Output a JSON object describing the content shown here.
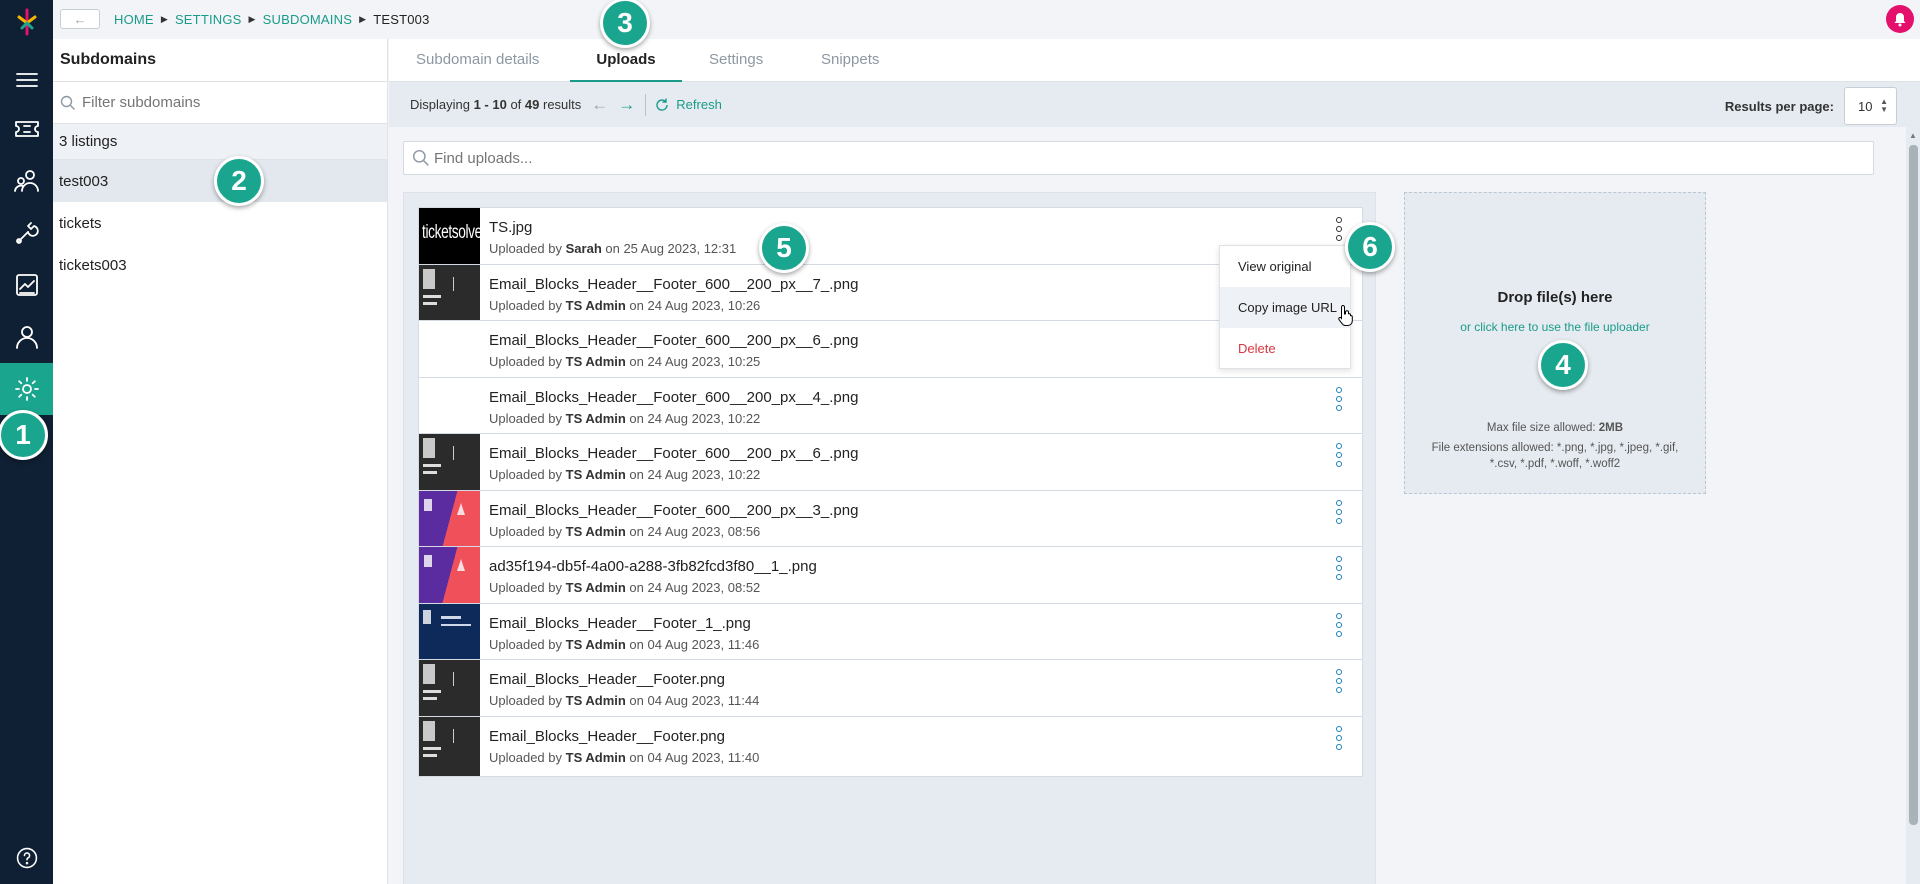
{
  "breadcrumb": {
    "back_label": "←",
    "items": [
      "HOME",
      "SETTINGS",
      "SUBDOMAINS"
    ],
    "current": "TEST003"
  },
  "sidebar_nav": [
    "menu-icon",
    "tickets-icon",
    "customers-icon",
    "tools-icon",
    "reports-icon",
    "user-icon",
    "settings-icon",
    "help-icon"
  ],
  "subdomains": {
    "title": "Subdomains",
    "filter_placeholder": "Filter subdomains",
    "count": "3 listings",
    "items": [
      "test003",
      "tickets",
      "tickets003"
    ]
  },
  "tabs": [
    "Subdomain details",
    "Uploads",
    "Settings",
    "Snippets"
  ],
  "toolbar": {
    "displaying_prefix": "Displaying ",
    "range": "1 - 10",
    "of": " of ",
    "total": "49",
    "suffix": " results",
    "refresh": "Refresh",
    "results_per_page_label": "Results per page:",
    "results_per_page": "10"
  },
  "search": {
    "placeholder": "Find uploads..."
  },
  "uploads": [
    {
      "name": "TS.jpg",
      "by": "Sarah",
      "on": "25 Aug 2023, 12:31"
    },
    {
      "name": "Email_Blocks_Header__Footer_600__200_px__7_.png",
      "by": "TS Admin",
      "on": "24 Aug 2023, 10:26"
    },
    {
      "name": "Email_Blocks_Header__Footer_600__200_px__6_.png",
      "by": "TS Admin",
      "on": "24 Aug 2023, 10:25"
    },
    {
      "name": "Email_Blocks_Header__Footer_600__200_px__4_.png",
      "by": "TS Admin",
      "on": "24 Aug 2023, 10:22"
    },
    {
      "name": "Email_Blocks_Header__Footer_600__200_px__6_.png",
      "by": "TS Admin",
      "on": "24 Aug 2023, 10:22"
    },
    {
      "name": "Email_Blocks_Header__Footer_600__200_px__3_.png",
      "by": "TS Admin",
      "on": "24 Aug 2023, 08:56"
    },
    {
      "name": "ad35f194-db5f-4a00-a288-3fb82fcd3f80__1_.png",
      "by": "TS Admin",
      "on": "24 Aug 2023, 08:52"
    },
    {
      "name": "Email_Blocks_Header__Footer_1_.png",
      "by": "TS Admin",
      "on": "04 Aug 2023, 11:46"
    },
    {
      "name": "Email_Blocks_Header__Footer.png",
      "by": "TS Admin",
      "on": "04 Aug 2023, 11:44"
    },
    {
      "name": "Email_Blocks_Header__Footer.png",
      "by": "TS Admin",
      "on": "04 Aug 2023, 11:40"
    }
  ],
  "uploaded_by_label": "Uploaded by ",
  "on_label": " on ",
  "context_menu": [
    "View original",
    "Copy image URL",
    "Delete"
  ],
  "dropzone": {
    "title": "Drop file(s) here",
    "link": "or click here to use the file uploader",
    "max_size_label": "Max file size allowed: ",
    "max_size": "2MB",
    "extensions_label": "File extensions allowed: ",
    "extensions": "*.png, *.jpg, *.jpeg, *.gif, *.csv, *.pdf, *.woff, *.woff2"
  },
  "thumb_text": "ticketsolve",
  "badges": [
    "1",
    "2",
    "3",
    "4",
    "5",
    "6"
  ],
  "colors": {
    "accent": "#1aa58f",
    "link": "#1a9b8a",
    "rail": "#102034",
    "bell": "#e5106c",
    "danger": "#d9363e"
  }
}
